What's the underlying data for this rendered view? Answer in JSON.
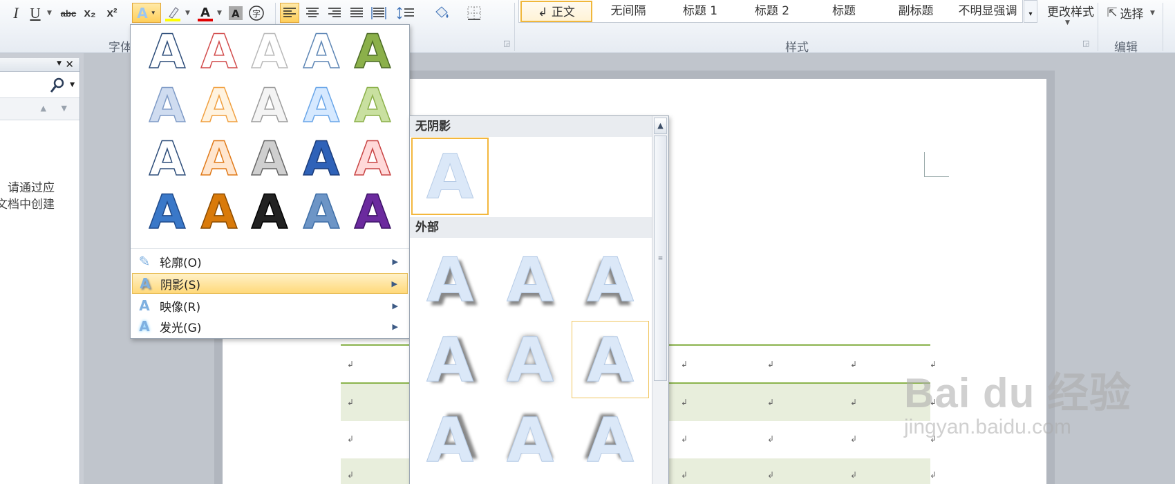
{
  "ribbon": {
    "font_group_label": "字体",
    "styles_group_label": "样式",
    "edit_group_label": "编辑",
    "toolbar": {
      "italic": "I",
      "underline": "U",
      "strike": "abc",
      "subscript": "x₂",
      "superscript": "x²",
      "change_styles": "更改样式",
      "select": "选择"
    },
    "styles": [
      {
        "label": "↲ 正文",
        "active": true
      },
      {
        "label": "无间隔"
      },
      {
        "label": "标题 1"
      },
      {
        "label": "标题 2"
      },
      {
        "label": "标题"
      },
      {
        "label": "副标题"
      },
      {
        "label": "不明显强调"
      }
    ]
  },
  "nav_pane": {
    "message_line1": "请通过应",
    "message_line2": "文档中创建"
  },
  "text_effects_menu": {
    "items": [
      {
        "label": "轮廓(O)",
        "icon": "outline-pen-icon"
      },
      {
        "label": "阴影(S)",
        "icon": "shadow-a-icon",
        "highlighted": true
      },
      {
        "label": "映像(R)",
        "icon": "reflection-a-icon"
      },
      {
        "label": "发光(G)",
        "icon": "glow-a-icon"
      }
    ]
  },
  "shadow_submenu": {
    "section_no_shadow": "无阴影",
    "section_outer": "外部",
    "glyph": "A"
  },
  "watermark": {
    "logo": "Bai du 经验",
    "sub": "jingyan.baidu.com"
  },
  "colors": {
    "accent_orange": "#f3b73d",
    "table_green": "#8ab34c",
    "table_shade": "#e8eedc"
  }
}
